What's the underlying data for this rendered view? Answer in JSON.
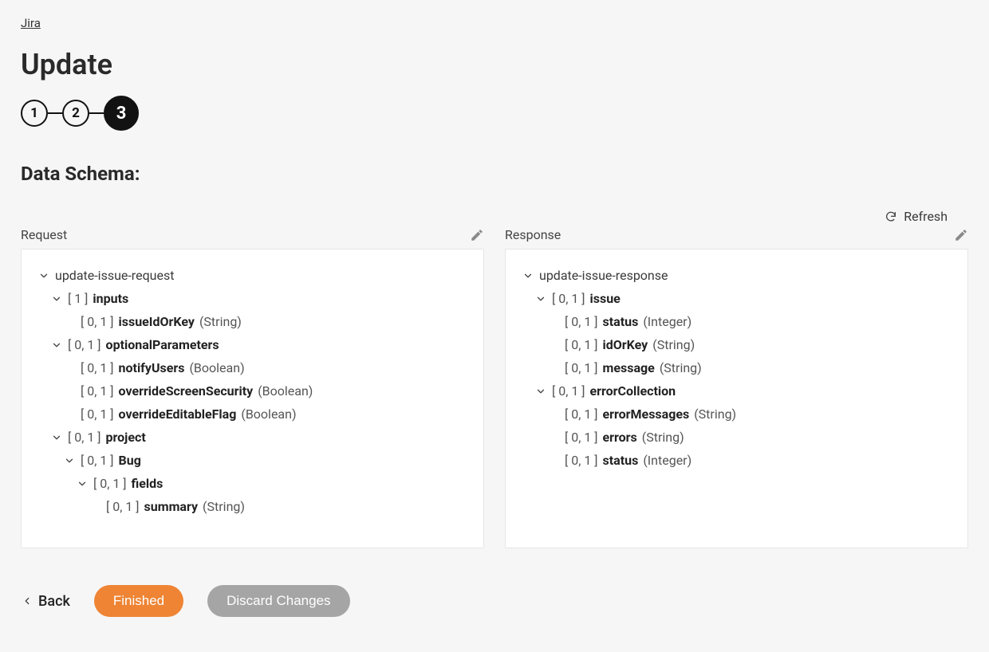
{
  "breadcrumb": {
    "label": "Jira"
  },
  "page_title": "Update",
  "stepper": {
    "steps": [
      "1",
      "2",
      "3"
    ],
    "active_index": 2
  },
  "section_title": "Data Schema:",
  "refresh_label": "Refresh",
  "request": {
    "title": "Request",
    "root": "update-issue-request",
    "nodes": {
      "inputs_card": "[ 1 ]",
      "inputs_name": "inputs",
      "issueIdOrKey_card": "[ 0, 1 ]",
      "issueIdOrKey_name": "issueIdOrKey",
      "issueIdOrKey_type": "(String)",
      "optionalParameters_card": "[ 0, 1 ]",
      "optionalParameters_name": "optionalParameters",
      "notifyUsers_card": "[ 0, 1 ]",
      "notifyUsers_name": "notifyUsers",
      "notifyUsers_type": "(Boolean)",
      "overrideScreenSecurity_card": "[ 0, 1 ]",
      "overrideScreenSecurity_name": "overrideScreenSecurity",
      "overrideScreenSecurity_type": "(Boolean)",
      "overrideEditableFlag_card": "[ 0, 1 ]",
      "overrideEditableFlag_name": "overrideEditableFlag",
      "overrideEditableFlag_type": "(Boolean)",
      "project_card": "[ 0, 1 ]",
      "project_name": "project",
      "Bug_card": "[ 0, 1 ]",
      "Bug_name": "Bug",
      "fields_card": "[ 0, 1 ]",
      "fields_name": "fields",
      "summary_card": "[ 0, 1 ]",
      "summary_name": "summary",
      "summary_type": "(String)"
    }
  },
  "response": {
    "title": "Response",
    "root": "update-issue-response",
    "nodes": {
      "issue_card": "[ 0, 1 ]",
      "issue_name": "issue",
      "status_card": "[ 0, 1 ]",
      "status_name": "status",
      "status_type": "(Integer)",
      "idOrKey_card": "[ 0, 1 ]",
      "idOrKey_name": "idOrKey",
      "idOrKey_type": "(String)",
      "message_card": "[ 0, 1 ]",
      "message_name": "message",
      "message_type": "(String)",
      "errorCollection_card": "[ 0, 1 ]",
      "errorCollection_name": "errorCollection",
      "errorMessages_card": "[ 0, 1 ]",
      "errorMessages_name": "errorMessages",
      "errorMessages_type": "(String)",
      "errors_card": "[ 0, 1 ]",
      "errors_name": "errors",
      "errors_type": "(String)",
      "ecStatus_card": "[ 0, 1 ]",
      "ecStatus_name": "status",
      "ecStatus_type": "(Integer)"
    }
  },
  "footer": {
    "back": "Back",
    "finished": "Finished",
    "discard": "Discard Changes"
  }
}
